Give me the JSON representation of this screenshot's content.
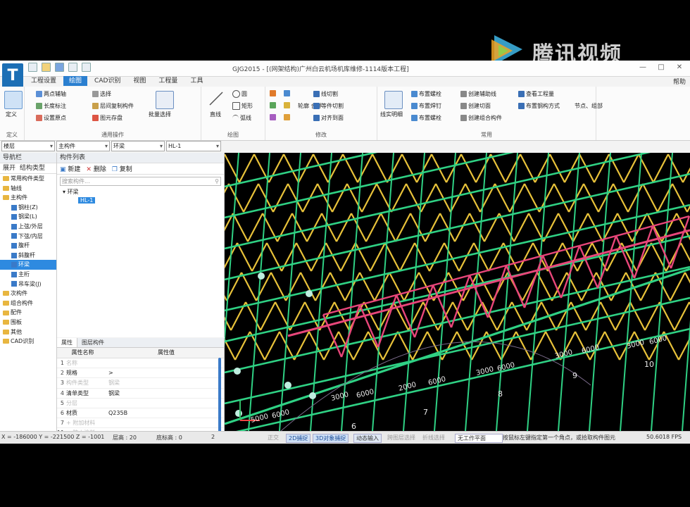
{
  "watermark": {
    "text": "腾讯视频"
  },
  "window": {
    "title": "GJG2015 - [(网架结构)广州白云机场机库维修-1114版本工程]",
    "controls": [
      "—",
      "□",
      "✕"
    ]
  },
  "app": {
    "logo_letter": "T"
  },
  "quick_access": [
    "new-icon",
    "open-icon",
    "save-icon",
    "undo-icon",
    "redo-icon"
  ],
  "menu": {
    "items": [
      "工程设置",
      "绘图",
      "CAD识别",
      "视图",
      "工程量",
      "工具"
    ],
    "active_index": 1,
    "help": "帮助"
  },
  "ribbon": {
    "groups": [
      {
        "label": "定义",
        "items": [
          "定义"
        ]
      },
      {
        "label": "通用操作",
        "items": [
          "两点辅轴",
          "长度标注",
          "设置原点",
          "选择",
          "层间复制构件",
          "图元存盘",
          "批量选择"
        ]
      },
      {
        "label": "绘图",
        "items": [
          "直线",
          "圆",
          "矩形",
          "弧线"
        ]
      },
      {
        "label": "修改",
        "items": [
          "延伸",
          "修剪",
          "镜像",
          "对齐",
          "打断",
          "偏移",
          "旋转",
          "移动",
          "复制",
          "轮廓",
          "合并",
          "删除"
        ]
      },
      {
        "label": "常用",
        "items": [
          "线切割",
          "等份切割",
          "对齐到面",
          "线实明细",
          "布置螺栓",
          "布置焊钉",
          "布置螺栓",
          "创建辅助线",
          "创建切面",
          "创建组合构件",
          "查看工程量",
          "布置钢结构",
          "节点、组部"
        ]
      }
    ],
    "common_items": [
      "线切割",
      "等件切割",
      "对齐到面",
      "线实明细",
      "布置螺栓",
      "布置焊钉",
      "布置螺栓",
      "创建辅助线",
      "创建切面",
      "创建组合构件",
      "查看工程量",
      "布置钢构方式"
    ],
    "node_label": "节点、组部",
    "batch_select": "批量选择",
    "line_label": "直线",
    "view_mode_label": "轮廓  合并"
  },
  "selectors": [
    {
      "value": "楼层"
    },
    {
      "value": "主构件"
    },
    {
      "value": "环梁"
    },
    {
      "value": "HL-1"
    }
  ],
  "nav": {
    "title": "导航栏",
    "sub": [
      "展开",
      "结构类型"
    ],
    "tree": [
      {
        "label": "常用构件类型",
        "type": "folder"
      },
      {
        "label": "轴线",
        "type": "folder"
      },
      {
        "label": "主构件",
        "type": "folder"
      },
      {
        "label": "钢柱(Z)",
        "type": "leaf"
      },
      {
        "label": "钢梁(L)",
        "type": "leaf"
      },
      {
        "label": "上弦/外层",
        "type": "leaf"
      },
      {
        "label": "下弦/内层",
        "type": "leaf"
      },
      {
        "label": "腹杆",
        "type": "leaf"
      },
      {
        "label": "斜腹杆",
        "type": "leaf"
      },
      {
        "label": "环梁",
        "type": "leaf",
        "selected": true
      },
      {
        "label": "主桁",
        "type": "leaf"
      },
      {
        "label": "吊车梁(J)",
        "type": "leaf"
      },
      {
        "label": "次构件",
        "type": "folder"
      },
      {
        "label": "组合构件",
        "type": "folder"
      },
      {
        "label": "配件",
        "type": "folder"
      },
      {
        "label": "围板",
        "type": "folder"
      },
      {
        "label": "其他",
        "type": "folder"
      },
      {
        "label": "CAD识别",
        "type": "folder"
      }
    ]
  },
  "component_list": {
    "title": "构件列表",
    "tools": [
      "新建",
      "删除",
      "复制"
    ],
    "search_placeholder": "搜索构件...",
    "tree_root": "环梁",
    "tree_child": "HL-1"
  },
  "properties": {
    "tabs": [
      "属性",
      "图层构件"
    ],
    "header": [
      "属性名称",
      "属性值"
    ],
    "rows": [
      {
        "num": "1",
        "name": "名称",
        "value": "",
        "dim": true
      },
      {
        "num": "2",
        "name": "规格",
        "value": ">",
        "dim": false
      },
      {
        "num": "3",
        "name": "构件类型",
        "value": "钢梁",
        "dim": true
      },
      {
        "num": "4",
        "name": "清单类型",
        "value": "钢梁",
        "dim": false
      },
      {
        "num": "5",
        "name": "分层",
        "value": "",
        "dim": true
      },
      {
        "num": "6",
        "name": "材质",
        "value": "Q235B",
        "dim": false
      },
      {
        "num": "7",
        "name": "+ 附加材料",
        "value": "",
        "dim": true
      },
      {
        "num": "11",
        "name": "+ 防火涂料",
        "value": "",
        "dim": true
      },
      {
        "num": "15",
        "name": "+ 标高属性",
        "value": "",
        "dim": true
      },
      {
        "num": "18",
        "name": "+ 显示样式",
        "value": "",
        "dim": true
      },
      {
        "num": "22",
        "name": "计算设置",
        "value": "按默认计算规则",
        "dim": false
      }
    ]
  },
  "viewport": {
    "dim_labels": [
      "5000",
      "6000",
      "3000",
      "6000",
      "2000",
      "6000",
      "3000",
      "6000",
      "3000",
      "6000",
      "3000",
      "6000"
    ],
    "axis_numbers": [
      "6",
      "7",
      "8",
      "9",
      "10"
    ]
  },
  "status": {
    "coords": "X = -186000 Y = -221500 Z = -1001",
    "layer_label": "层高 : 20",
    "base_height": "底标高 : 0",
    "count": "2",
    "buttons": [
      "正交",
      "2D捕捉",
      "3D对象捕捉",
      "动态输入",
      "跨图层选择",
      "折线选择"
    ],
    "workplane": "无工作平面",
    "hint": "按鼠标左键指定第一个角点，或拾取构件图元",
    "fps": "50.6018 FPS"
  },
  "colors": {
    "upper_chord": "#e8c23a",
    "lower_grid": "#2fd184",
    "ring_beam": "#e8467a",
    "accent": "#2a7fd0"
  }
}
